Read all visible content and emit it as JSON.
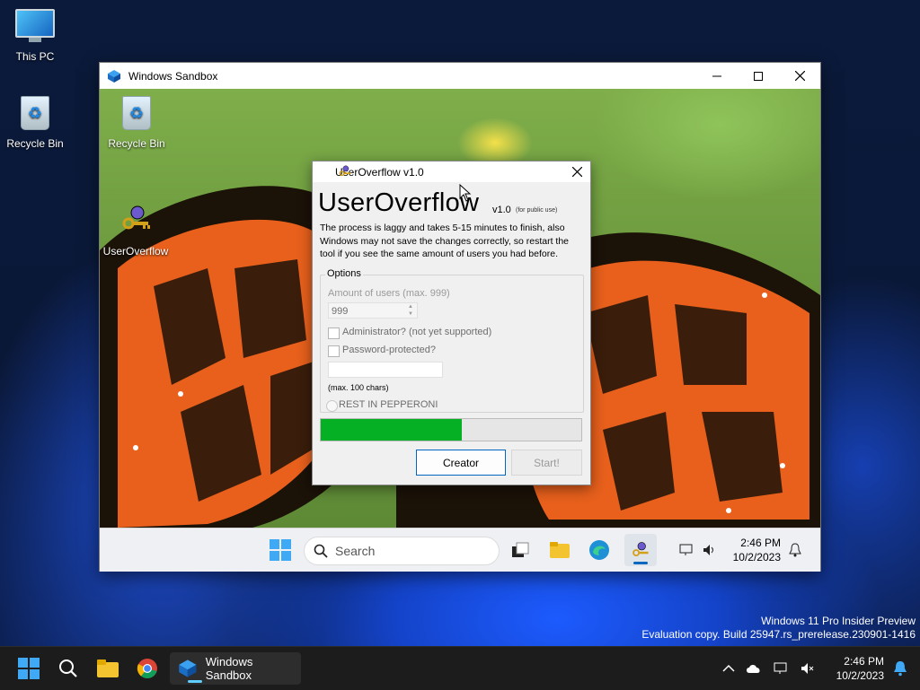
{
  "host_desktop": {
    "icons": [
      {
        "label": "This PC",
        "icon": "computer-icon"
      },
      {
        "label": "Recycle Bin",
        "icon": "recycle-bin-icon"
      }
    ],
    "watermark": {
      "line1": "Windows 11 Pro Insider Preview",
      "line2": "Evaluation copy. Build 25947.rs_prerelease.230901-1416"
    }
  },
  "host_taskbar": {
    "apps": [
      {
        "name": "start",
        "icon": "windows-logo-icon"
      },
      {
        "name": "search",
        "icon": "search-icon"
      },
      {
        "name": "file-explorer",
        "icon": "folder-icon"
      },
      {
        "name": "chrome",
        "icon": "chrome-icon"
      }
    ],
    "active_app_label": "Windows Sandbox",
    "clock": {
      "time": "2:46 PM",
      "date": "10/2/2023"
    }
  },
  "sandbox": {
    "title": "Windows Sandbox",
    "desktop_icons": [
      {
        "label": "Recycle Bin",
        "icon": "recycle-bin-icon"
      },
      {
        "label": "UserOverflow",
        "icon": "useroverflow-app-icon"
      }
    ],
    "taskbar": {
      "search_placeholder": "Search",
      "clock": {
        "time": "2:46 PM",
        "date": "10/2/2023"
      }
    }
  },
  "dialog": {
    "title": "UserOverflow v1.0",
    "app_name": "UserOverflow",
    "version": "v1.0",
    "edition": "(for public use)",
    "description": "The process is laggy and takes 5-15 minutes to finish, also Windows may not save the changes correctly, so restart the tool if you see the same amount of users you had before.",
    "options": {
      "legend": "Options",
      "amount_label": "Amount of users (max. 999)",
      "amount_value": "999",
      "admin_label": "Administrator? (not yet supported)",
      "admin_checked": false,
      "password_label": "Password-protected?",
      "password_checked": false,
      "password_hint": "(max. 100 chars)",
      "radio_label": "REST IN PEPPERONI"
    },
    "progress_fraction": 0.54,
    "buttons": {
      "creator": "Creator",
      "start": "Start!"
    }
  }
}
